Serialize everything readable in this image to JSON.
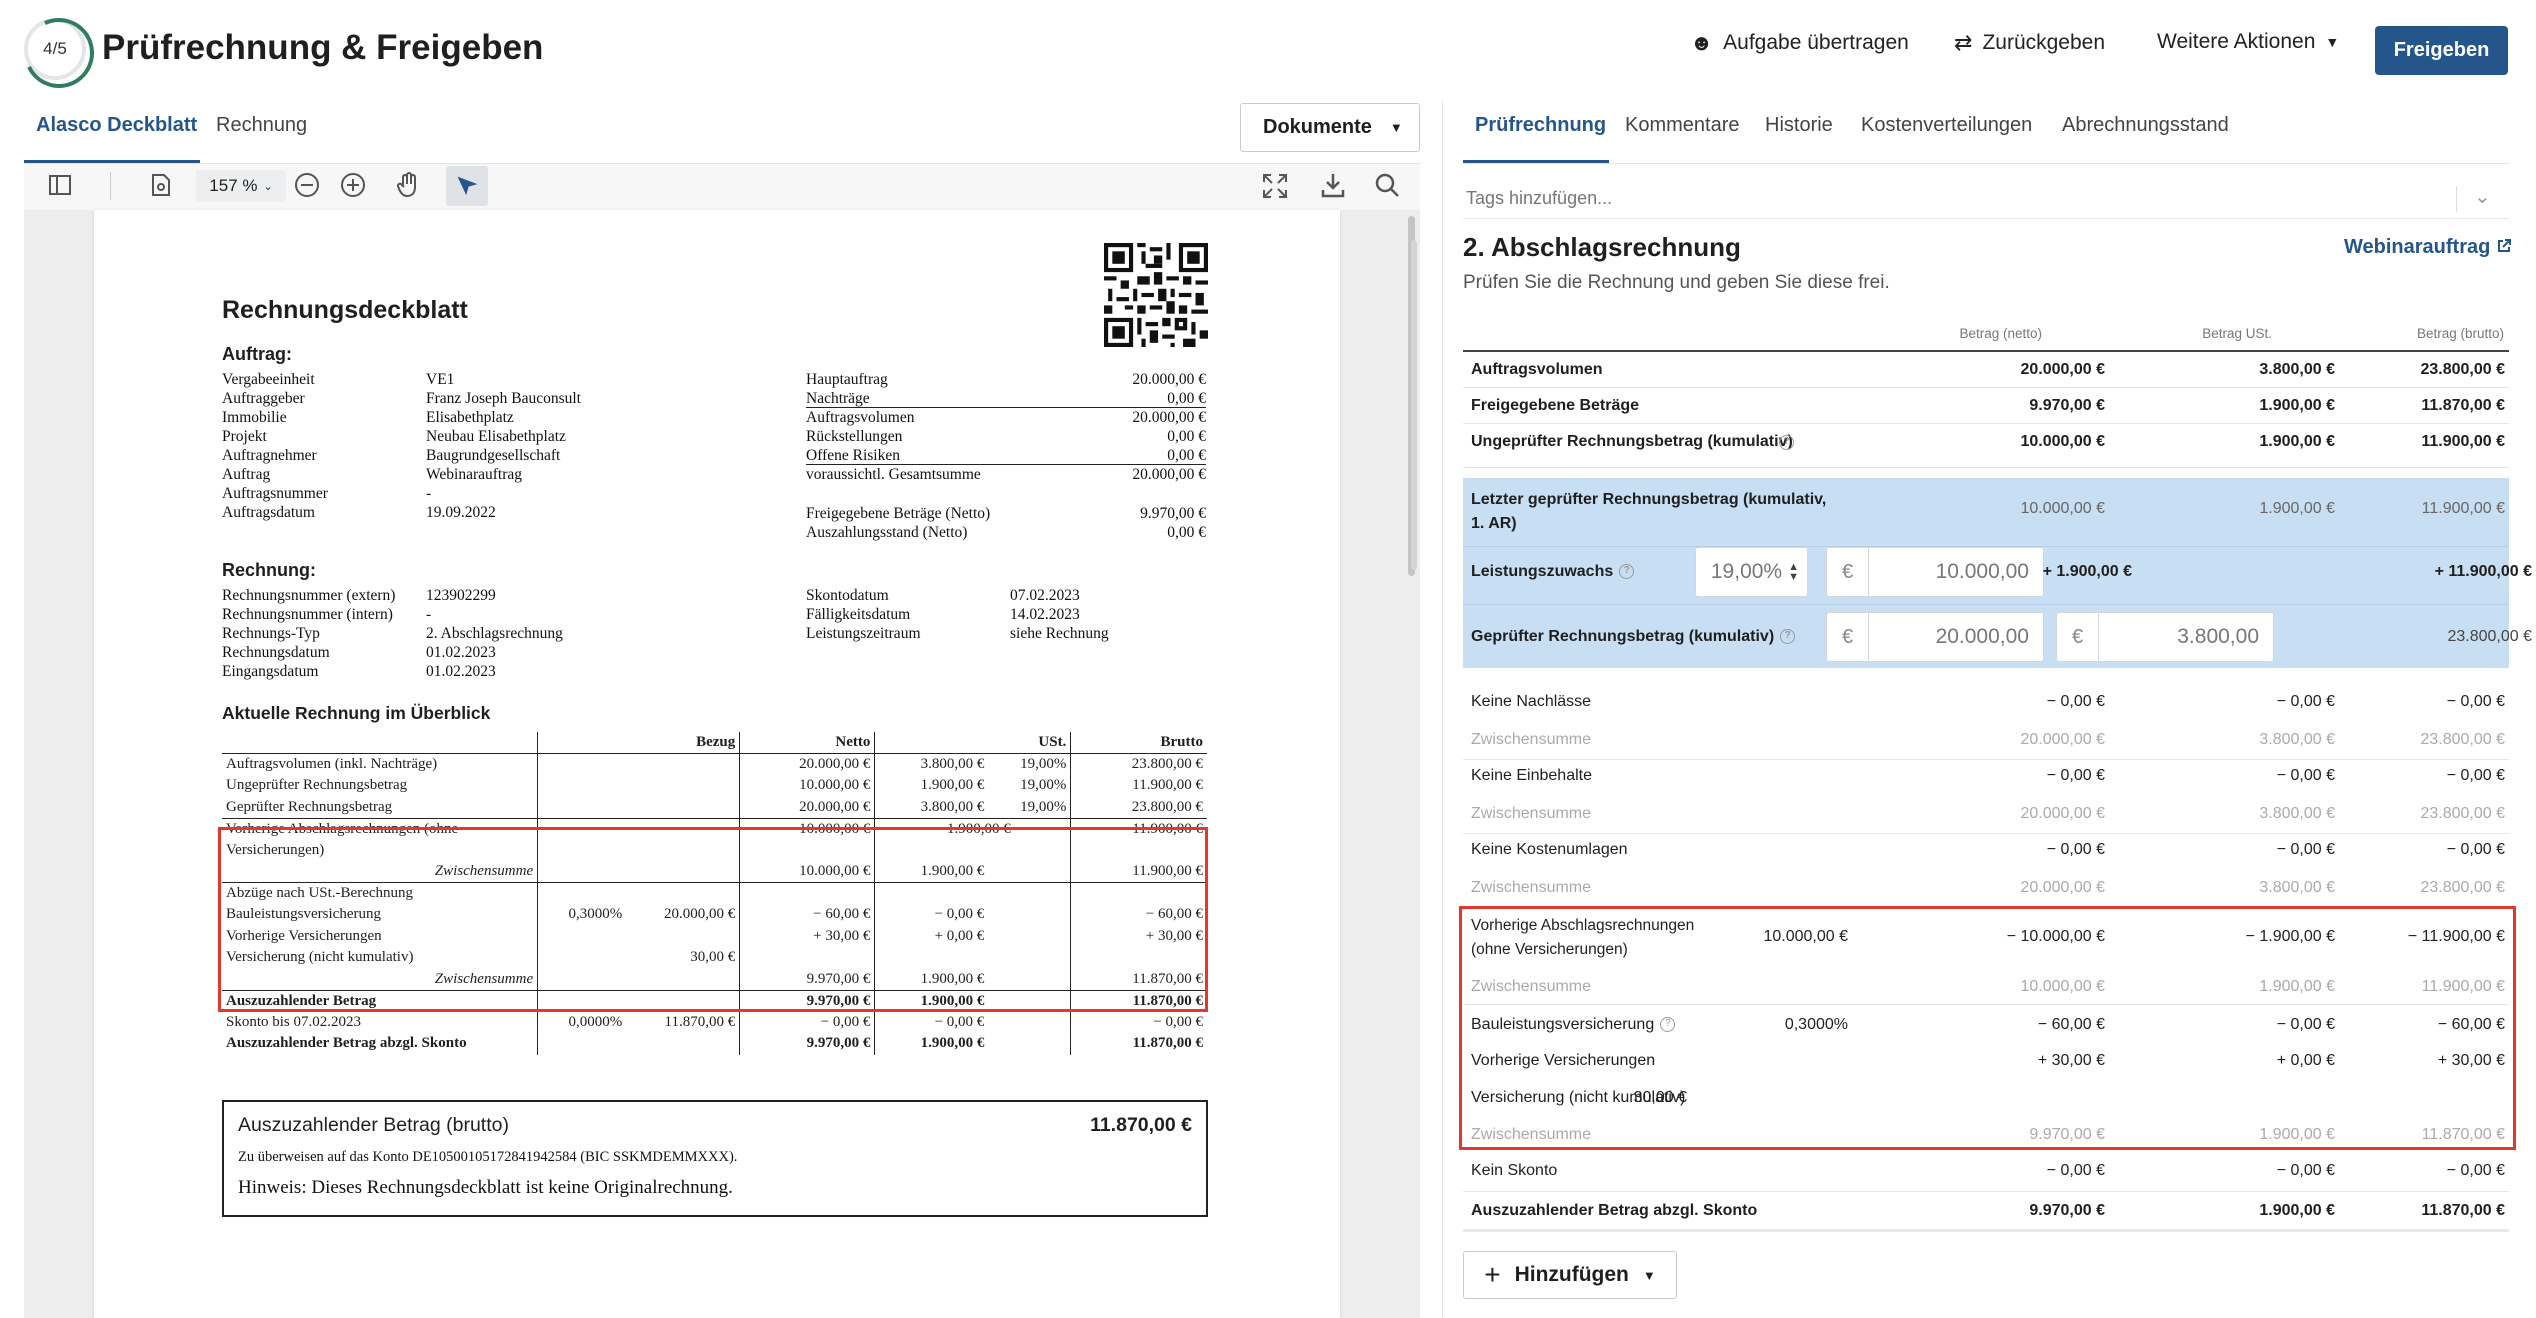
{
  "header": {
    "step": "4/5",
    "title": "Prüfrechnung & Freigeben",
    "assign": "Aufgabe übertragen",
    "return": "Zurückgeben",
    "more": "Weitere Aktionen",
    "release": "Freigeben"
  },
  "left_tabs": [
    "Alasco Deckblatt",
    "Rechnung"
  ],
  "doc_select": "Dokumente",
  "zoom": "157 %",
  "doc": {
    "title": "Rechnungsdeckblatt",
    "auftrag_h": "Auftrag:",
    "auftrag": [
      [
        "Vergabeeinheit",
        "VE1"
      ],
      [
        "Auftraggeber",
        "Franz Joseph Bauconsult"
      ],
      [
        "Immobilie",
        "Elisabethplatz"
      ],
      [
        "Projekt",
        "Neubau Elisabethplatz"
      ],
      [
        "Auftragnehmer",
        "Baugrundgesellschaft"
      ],
      [
        "Auftrag",
        "Webinarauftrag"
      ],
      [
        "Auftragsnummer",
        "-"
      ],
      [
        "Auftragsdatum",
        "19.09.2022"
      ]
    ],
    "summen": [
      [
        "Hauptauftrag",
        "20.000,00 €"
      ],
      [
        "Nachträge",
        "0,00 €"
      ],
      [
        "Auftragsvolumen",
        "20.000,00 €"
      ],
      [
        "Rückstellungen",
        "0,00 €"
      ],
      [
        "Offene Risiken",
        "0,00 €"
      ],
      [
        "voraussichtl. Gesamtsumme",
        "20.000,00 €"
      ]
    ],
    "freigabe": [
      [
        "Freigegebene Beträge (Netto)",
        "9.970,00 €"
      ],
      [
        "Auszahlungsstand (Netto)",
        "0,00 €"
      ]
    ],
    "rechnung_h": "Rechnung:",
    "rechnung": [
      [
        "Rechnungsnummer (extern)",
        "123902299"
      ],
      [
        "Rechnungsnummer (intern)",
        "-"
      ],
      [
        "Rechnungs-Typ",
        "2. Abschlagsrechnung"
      ],
      [
        "Rechnungsdatum",
        "01.02.2023"
      ],
      [
        "Eingangsdatum",
        "01.02.2023"
      ]
    ],
    "termine": [
      [
        "Skontodatum",
        "07.02.2023"
      ],
      [
        "Fälligkeitsdatum",
        "14.02.2023"
      ],
      [
        "Leistungszeitraum",
        "siehe Rechnung"
      ]
    ],
    "overview_h": "Aktuelle Rechnung im Überblick",
    "cols": [
      "Bezug",
      "Netto",
      "USt.",
      "Brutto"
    ],
    "rows": [
      [
        "Auftragsvolumen (inkl. Nachträge)",
        "",
        "",
        "20.000,00 €",
        "3.800,00 €",
        "19,00%",
        "23.800,00 €"
      ],
      [
        "Ungeprüfter Rechnungsbetrag",
        "",
        "",
        "10.000,00 €",
        "1.900,00 €",
        "19,00%",
        "11.900,00 €"
      ],
      [
        "Geprüfter Rechnungsbetrag",
        "",
        "",
        "20.000,00 €",
        "3.800,00 €",
        "19,00%",
        "23.800,00 €"
      ]
    ],
    "prev_label1": "Vorherige Abschlagsrechnungen (ohne",
    "prev_label2": "Versicherungen)",
    "prev": [
      "− 10.000,00 €",
      "− 1.900,00 €",
      "− 11.900,00 €"
    ],
    "zw": "Zwischensumme",
    "prev_zw": [
      "10.000,00 €",
      "1.900,00 €",
      "11.900,00 €"
    ],
    "abz_h": "Abzüge nach USt.-Berechnung",
    "abz": [
      [
        "Bauleistungsversicherung",
        "0,3000%",
        "20.000,00 €",
        "− 60,00 €",
        "− 0,00 €",
        "− 60,00 €"
      ],
      [
        "Vorherige Versicherungen",
        "",
        "",
        "+ 30,00 €",
        "+ 0,00 €",
        "+ 30,00 €"
      ],
      [
        "Versicherung (nicht kumulativ)",
        "",
        "30,00 €",
        "",
        "",
        ""
      ]
    ],
    "abz_zw": [
      "9.970,00 €",
      "1.900,00 €",
      "11.870,00 €"
    ],
    "pay": [
      [
        "Auszuzahlender Betrag",
        "",
        "",
        "9.970,00 €",
        "1.900,00 €",
        "11.870,00 €"
      ],
      [
        "Skonto bis 07.02.2023",
        "0,0000%",
        "11.870,00 €",
        "− 0,00 €",
        "− 0,00 €",
        "− 0,00 €"
      ],
      [
        "Auszuzahlender Betrag abzgl. Skonto",
        "",
        "",
        "9.970,00 €",
        "1.900,00 €",
        "11.870,00 €"
      ]
    ],
    "box_title": "Auszuzahlender Betrag (brutto)",
    "box_amount": "11.870,00 €",
    "box_line": "Zu überweisen auf das Konto DE10500105172841942584 (BIC SSKMDEMMXXX).",
    "box_note": "Hinweis: Dieses Rechnungsdeckblatt ist keine Originalrechnung."
  },
  "right_tabs": [
    "Prüfrechnung",
    "Kommentare",
    "Historie",
    "Kostenverteilungen",
    "Abrechnungsstand"
  ],
  "tags_placeholder": "Tags hinzufügen...",
  "panel": {
    "title": "2. Abschlagsrechnung",
    "subtitle": "Prüfen Sie die Rechnung und geben Sie diese frei.",
    "link": "Webinarauftrag",
    "col_headers": [
      "Betrag (netto)",
      "Betrag USt.",
      "Betrag (brutto)"
    ],
    "top_rows": [
      [
        "Auftragsvolumen",
        "20.000,00 €",
        "3.800,00 €",
        "23.800,00 €"
      ],
      [
        "Freigegebene Beträge",
        "9.970,00 €",
        "1.900,00 €",
        "11.870,00 €"
      ],
      [
        "Ungeprüfter Rechnungsbetrag (kumulativ)",
        "10.000,00 €",
        "1.900,00 €",
        "11.900,00 €"
      ]
    ],
    "last_label1": "Letzter geprüfter Rechnungsbetrag (kumulativ,",
    "last_label2": "1. AR)",
    "last": [
      "10.000,00 €",
      "1.900,00 €",
      "11.900,00 €"
    ],
    "growth_label": "Leistungszuwachs",
    "growth_rate": "19,00%",
    "currency": "€",
    "growth_net": "10.000,00",
    "growth_ust": "+ 1.900,00 €",
    "growth_brutto": "+ 11.900,00 €",
    "checked_label": "Geprüfter Rechnungsbetrag (kumulativ)",
    "checked_net": "20.000,00",
    "checked_ust": "3.800,00",
    "checked_brutto": "23.800,00 €",
    "lower": [
      {
        "l": "Keine Nachlässe",
        "v": [
          "− 0,00 €",
          "− 0,00 €",
          "− 0,00 €"
        ]
      },
      {
        "l": "Zwischensumme",
        "v": [
          "20.000,00 €",
          "3.800,00 €",
          "23.800,00 €"
        ],
        "grey": true
      },
      {
        "l": "Keine Einbehalte",
        "v": [
          "− 0,00 €",
          "− 0,00 €",
          "− 0,00 €"
        ]
      },
      {
        "l": "Zwischensumme",
        "v": [
          "20.000,00 €",
          "3.800,00 €",
          "23.800,00 €"
        ],
        "grey": true
      },
      {
        "l": "Keine Kostenumlagen",
        "v": [
          "− 0,00 €",
          "− 0,00 €",
          "− 0,00 €"
        ]
      },
      {
        "l": "Zwischensumme",
        "v": [
          "20.000,00 €",
          "3.800,00 €",
          "23.800,00 €"
        ],
        "grey": true
      }
    ],
    "prev_label1": "Vorherige Abschlagsrechnungen",
    "prev_label2": "(ohne Versicherungen)",
    "prev_base": "10.000,00 €",
    "prev": [
      "− 10.000,00 €",
      "− 1.900,00 €",
      "− 11.900,00 €"
    ],
    "prev_zw": [
      "10.000,00 €",
      "1.900,00 €",
      "11.900,00 €"
    ],
    "ins_label": "Bauleistungsversicherung",
    "ins_rate": "0,3000%",
    "ins": [
      "− 60,00 €",
      "− 0,00 €",
      "− 60,00 €"
    ],
    "previns_label": "Vorherige Versicherungen",
    "previns": [
      "+ 30,00 €",
      "+ 0,00 €",
      "+ 30,00 €"
    ],
    "nk_label": "Versicherung (nicht kumulativ)",
    "nk_base": "30,00 €",
    "ins_zw": [
      "9.970,00 €",
      "1.900,00 €",
      "11.870,00 €"
    ],
    "skonto_label": "Kein Skonto",
    "skonto": [
      "− 0,00 €",
      "− 0,00 €",
      "− 0,00 €"
    ],
    "final_label": "Auszuzahlender Betrag abzgl. Skonto",
    "final": [
      "9.970,00 €",
      "1.900,00 €",
      "11.870,00 €"
    ],
    "add": "Hinzufügen",
    "zw": "Zwischensumme"
  }
}
